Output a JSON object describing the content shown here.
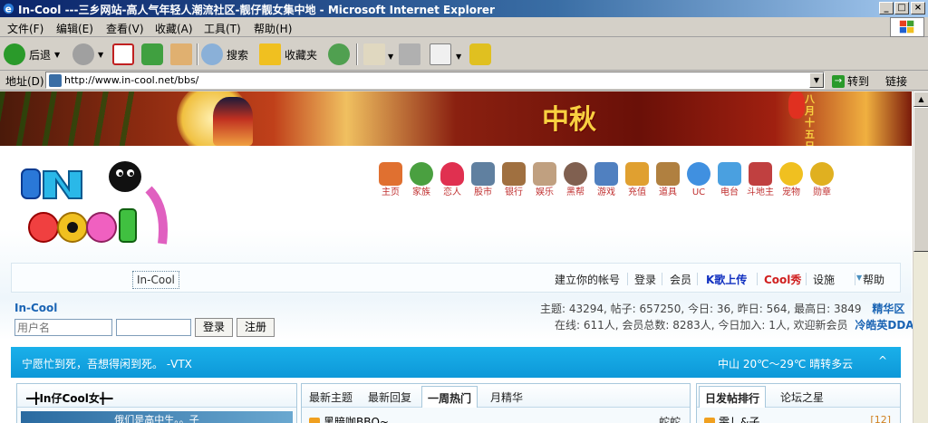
{
  "window": {
    "title": "In-Cool ---三乡网站-高人气年轻人潮流社区-靓仔靓女集中地 - Microsoft Internet Explorer",
    "min": "_",
    "max": "□",
    "close": "×"
  },
  "menu": [
    "文件(F)",
    "编辑(E)",
    "查看(V)",
    "收藏(A)",
    "工具(T)",
    "帮助(H)"
  ],
  "toolbar": {
    "back": "后退",
    "search": "搜索",
    "favorites": "收藏夹"
  },
  "address": {
    "label": "地址(D)",
    "url": "http://www.in-cool.net/bbs/",
    "go": "转到",
    "links": "链接"
  },
  "banner": {
    "text": "中秋",
    "vertical": "八月十五日夜"
  },
  "nav": [
    {
      "label": "主页",
      "color": "#e07030"
    },
    {
      "label": "家族",
      "color": "#4aa040"
    },
    {
      "label": "恋人",
      "color": "#e03050"
    },
    {
      "label": "股市",
      "color": "#6080a0"
    },
    {
      "label": "银行",
      "color": "#a07040"
    },
    {
      "label": "娱乐",
      "color": "#c0a080"
    },
    {
      "label": "黑帮",
      "color": "#806050"
    },
    {
      "label": "游戏",
      "color": "#5080c0"
    },
    {
      "label": "充值",
      "color": "#e0a030"
    },
    {
      "label": "道具",
      "color": "#b08040"
    },
    {
      "label": "UC",
      "color": "#4090e0"
    },
    {
      "label": "电台",
      "color": "#4aa0e0"
    },
    {
      "label": "斗地主",
      "color": "#c04040"
    },
    {
      "label": "宠物",
      "color": "#f0c020"
    },
    {
      "label": "勋章",
      "color": "#e0b020"
    }
  ],
  "userbar": {
    "tab": "In-Cool",
    "create": "建立你的帐号",
    "login": "登录",
    "member": "会员",
    "karaoke": "K歌上传",
    "coolshow": "Cool秀",
    "settings": "设施",
    "help": "帮助"
  },
  "site": {
    "name": "In-Cool",
    "username_placeholder": "用户名",
    "login_btn": "登录",
    "register_btn": "注册"
  },
  "stats": {
    "line1": "主题: 43294, 帖子: 657250, 今日: 36, 昨日: 564, 最高日: 3849",
    "digest": "精华区",
    "line2": "在线: 611人, 会员总数: 8283人, 今日加入: 1人, 欢迎新会员",
    "newmember": "冷皓英DDA"
  },
  "notice": {
    "msg": "宁愿忙到死，吾想得闲到死。 -VTX",
    "weather": "中山  20℃～29℃ 晴转多云",
    "caret": "^"
  },
  "panels": {
    "left": {
      "title": "━╋In仔Cool女╋━",
      "caption": "俄们是高中生。。子"
    },
    "center": {
      "tabs": [
        "最新主题",
        "最新回复",
        "一周热门",
        "月精华"
      ],
      "active": 2,
      "row_title": "黑暗咖BBQ~",
      "row_author": "蛇蛇"
    },
    "right": {
      "tabs": [
        "日发帖排行",
        "论坛之星"
      ],
      "active": 0,
      "row_title": "雯し&子",
      "row_rank": "[12]"
    }
  }
}
